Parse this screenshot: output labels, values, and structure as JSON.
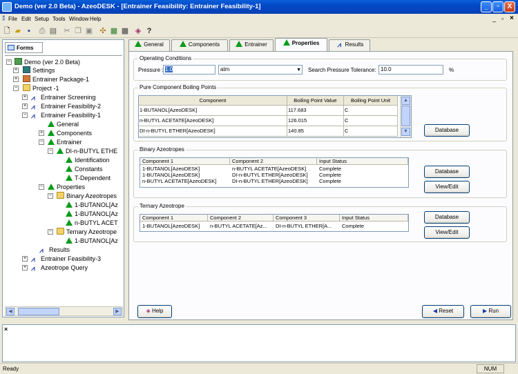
{
  "window": {
    "title": "Demo (ver 2.0 Beta) - AzeoDESK - [Entrainer Feasibility: Entrainer Feasibility-1]",
    "minimize": "_",
    "restore": "▫",
    "close": "X",
    "mdi_min": "_",
    "mdi_restore": "▫",
    "mdi_close": "×"
  },
  "menu": [
    "File",
    "Edit",
    "Setup",
    "Tools",
    "Window",
    "Help"
  ],
  "left": {
    "tab": "Forms",
    "tree": [
      "Demo (ver 2.0 Beta)",
      "Settings",
      "Entrainer Package-1",
      "Project -1",
      "Entrainer Screening",
      "Entrainer Feasibility-2",
      "Entrainer Feasibility-1",
      "General",
      "Components",
      "Entrainer",
      "DI-n-BUTYL ETHE",
      "Identification",
      "Constants",
      "T-Dependent",
      "Properties",
      "Binary Azeotropes",
      "1-BUTANOL[Az",
      "1-BUTANOL[Az",
      "n-BUTYL ACET",
      "Ternary Azeotrope",
      "1-BUTANOL[Az",
      "Results",
      "Entrainer Feasibility-3",
      "Azeotrope Query"
    ]
  },
  "tabs": [
    "General",
    "Components",
    "Entrainer",
    "Properties",
    "Results"
  ],
  "operating": {
    "title": "Operating Conditions",
    "pressure_label": "Pressure :",
    "pressure_value": "1.0",
    "pressure_unit": "atm",
    "tolerance_label": "Search Pressure Tolerance:",
    "tolerance_value": "10.0",
    "tolerance_unit": "%"
  },
  "boiling": {
    "title": "Pure Component Boiling Points",
    "headers": [
      "Component",
      "Boiling Point Value",
      "Boiling Point Unit"
    ],
    "rows": [
      [
        "1-BUTANOL[AzeoDESK]",
        "117.683",
        "C"
      ],
      [
        "n-BUTYL ACETATE[AzeoDESK]",
        "126.015",
        "C"
      ],
      [
        "DI-n-BUTYL ETHER[AzeoDESK]",
        "140.85",
        "C"
      ]
    ],
    "database": "Database"
  },
  "binary": {
    "title": "Binary Azeotropes",
    "headers": [
      "Component 1",
      "Component 2",
      "Input Status"
    ],
    "rows": [
      [
        "1-BUTANOL[AzeoDESK]",
        "n-BUTYL ACETATE[AzeoDESK]",
        "Complete"
      ],
      [
        "1-BUTANOL[AzeoDESK]",
        "DI-n-BUTYL ETHER[AzeoDESK]",
        "Complete"
      ],
      [
        "n-BUTYL ACETATE[AzeoDESK]",
        "DI-n-BUTYL ETHER[AzeoDESK]",
        "Complete"
      ]
    ],
    "database": "Database",
    "view_edit": "View/Edit"
  },
  "ternary": {
    "title": "Ternary Azeotrope",
    "headers": [
      "Component 1",
      "Component 2",
      "Component 3",
      "Input Status"
    ],
    "rows": [
      [
        "1-BUTANOL[AzeoDESK]",
        "n-BUTYL ACETATE[Az...",
        "DI-n-BUTYL ETHER[A...",
        "Complete"
      ]
    ],
    "database": "Database",
    "view_edit": "View/Edit"
  },
  "bottom": {
    "help": "Help",
    "reset": "Reset",
    "run": "Run"
  },
  "output": {
    "close": "×"
  },
  "status": {
    "text": "Ready",
    "num": "NUM"
  }
}
